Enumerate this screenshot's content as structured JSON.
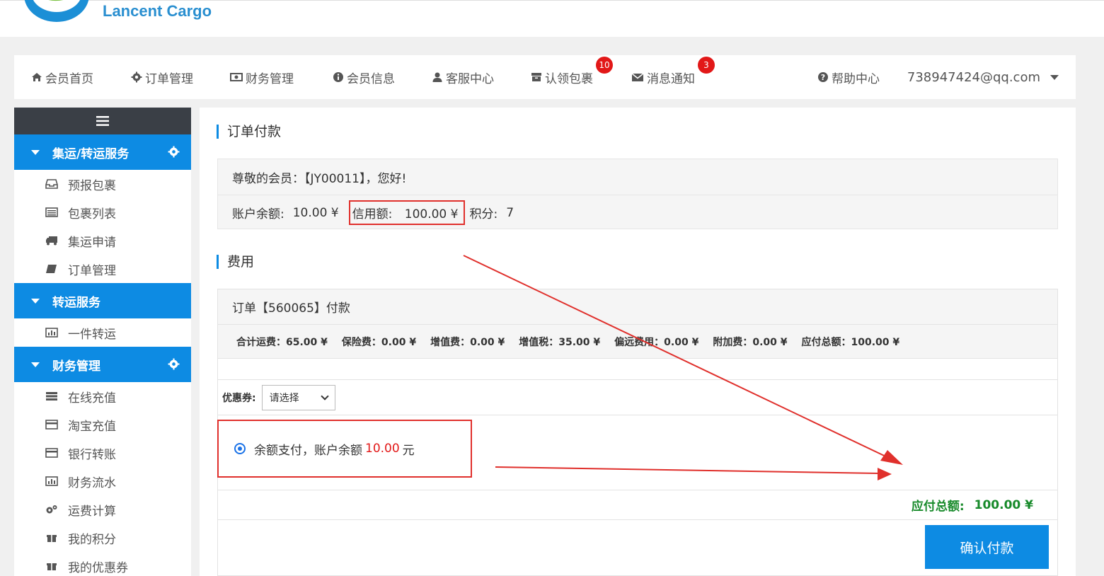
{
  "header": {
    "logo_text": "Lancent Cargo"
  },
  "nav": {
    "items": [
      {
        "label": "会员首页",
        "icon": "home-icon"
      },
      {
        "label": "订单管理",
        "icon": "gear-icon"
      },
      {
        "label": "财务管理",
        "icon": "money-icon"
      },
      {
        "label": "会员信息",
        "icon": "info-icon"
      },
      {
        "label": "客服中心",
        "icon": "user-icon"
      },
      {
        "label": "认领包裹",
        "icon": "archive-icon",
        "badge": "10"
      },
      {
        "label": "消息通知",
        "icon": "envelope-icon",
        "badge": "3"
      }
    ],
    "help": "帮助中心",
    "user": "738947424@qq.com"
  },
  "sidebar": {
    "groups": [
      {
        "title": "集运/转运服务",
        "items": [
          "预报包裹",
          "包裹列表",
          "集运申请",
          "订单管理"
        ]
      },
      {
        "title": "转运服务",
        "items": [
          "一件转运"
        ]
      },
      {
        "title": "财务管理",
        "items": [
          "在线充值",
          "淘宝充值",
          "银行转账",
          "财务流水",
          "运费计算",
          "我的积分",
          "我的优惠券"
        ]
      }
    ]
  },
  "main": {
    "title": "订单付款",
    "greeting": "尊敬的会员：【JY00011】，您好!",
    "balance_label": "账户余额:",
    "balance_value": "10.00 ¥",
    "credit_label": "信用额:",
    "credit_value": "100.00 ¥",
    "points_label": "积分:",
    "points_value": "7",
    "fee_title": "费用",
    "order_head": "订单【560065】付款",
    "fees": [
      "合计运费：65.00 ¥",
      "保险费：0.00 ¥",
      "增值费：0.00 ¥",
      "增值税：35.00 ¥",
      "偏远费用：0.00 ¥",
      "附加费：0.00 ¥",
      "应付总额：100.00 ¥"
    ],
    "coupon_label": "优惠券:",
    "coupon_selected": "请选择",
    "pay_text": "余额支付，账户余额",
    "pay_amount": "10.00",
    "pay_unit": "元",
    "total_label": "应付总额:",
    "total_value": "100.00 ¥",
    "confirm_label": "确认付款"
  },
  "colors": {
    "accent": "#0d8be3",
    "highlight": "#e0302c",
    "total": "#178a2a"
  }
}
